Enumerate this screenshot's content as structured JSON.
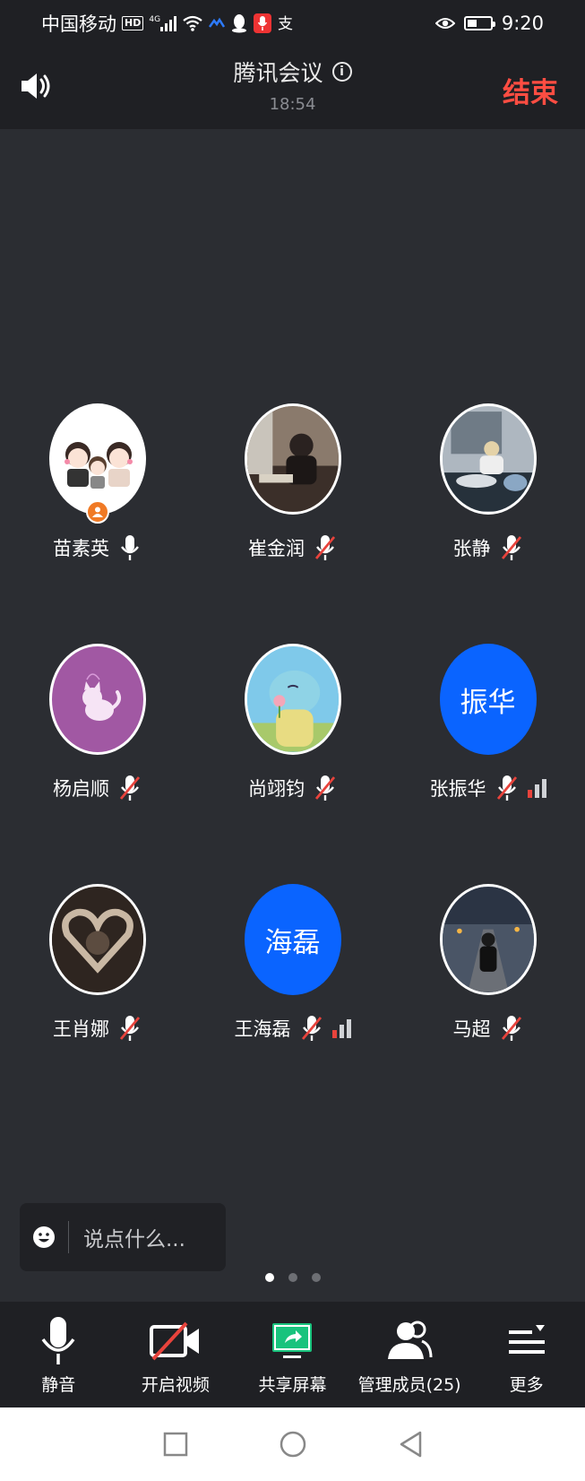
{
  "status_bar": {
    "carrier": "中国移动",
    "net_badge": "HD",
    "net_type": "4G",
    "time": "9:20",
    "battery_level": 0.35
  },
  "header": {
    "title": "腾讯会议",
    "timer": "18:54",
    "end_label": "结束"
  },
  "members": [
    {
      "name": "苗素英",
      "avatar": "photo",
      "mic": "on",
      "host": true
    },
    {
      "name": "崔金润",
      "avatar": "photo",
      "mic": "muted"
    },
    {
      "name": "张静",
      "avatar": "photo",
      "mic": "muted"
    },
    {
      "name": "杨启顺",
      "avatar": "photo",
      "mic": "muted"
    },
    {
      "name": "尚翊钧",
      "avatar": "photo",
      "mic": "muted"
    },
    {
      "name": "张振华",
      "avatar_text": "振华",
      "mic": "muted",
      "signal": "weak"
    },
    {
      "name": "王肖娜",
      "avatar": "photo",
      "mic": "muted"
    },
    {
      "name": "王海磊",
      "avatar_text": "海磊",
      "mic": "muted",
      "signal": "weak"
    },
    {
      "name": "马超",
      "avatar": "photo",
      "mic": "muted"
    }
  ],
  "chat": {
    "placeholder": "说点什么..."
  },
  "pager": {
    "pages": 3,
    "current": 1
  },
  "toolbar": [
    {
      "label": "静音",
      "icon": "microphone-icon"
    },
    {
      "label": "开启视频",
      "icon": "video-off-icon"
    },
    {
      "label": "共享屏幕",
      "icon": "share-screen-icon"
    },
    {
      "label": "管理成员(25)",
      "icon": "members-icon"
    },
    {
      "label": "更多",
      "icon": "more-menu-icon"
    }
  ],
  "colors": {
    "background": "#2b2d32",
    "bar": "#1f2024",
    "accent_red": "#ff4d42",
    "avatar_blue": "#0a64ff",
    "host_orange": "#f07a25"
  }
}
